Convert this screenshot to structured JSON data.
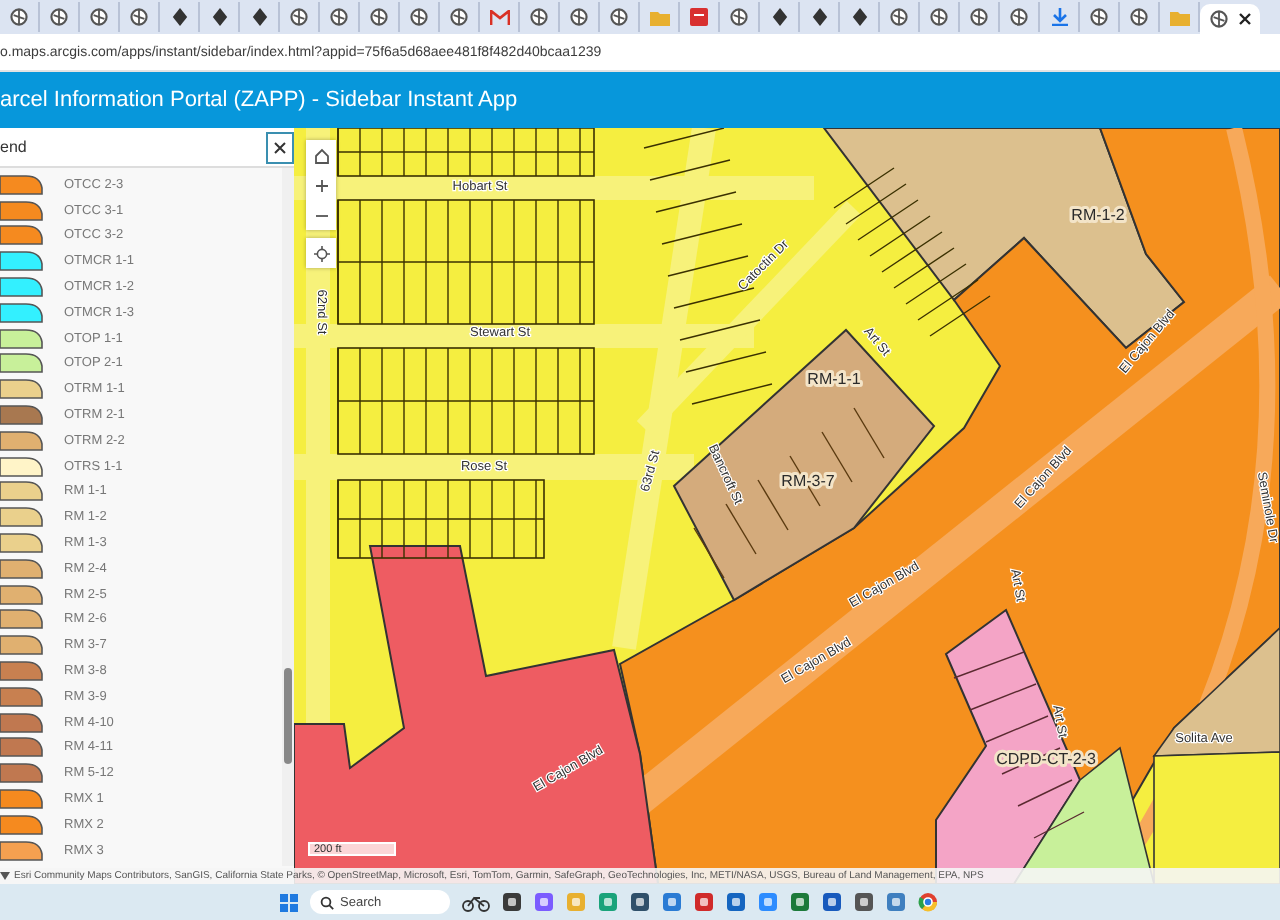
{
  "tabs": [
    {
      "kind": "globe",
      "selected": false
    },
    {
      "kind": "globe",
      "selected": false
    },
    {
      "kind": "globe",
      "selected": false
    },
    {
      "kind": "globe",
      "selected": false
    },
    {
      "kind": "pin",
      "selected": false
    },
    {
      "kind": "pin",
      "selected": false
    },
    {
      "kind": "pin",
      "selected": false
    },
    {
      "kind": "globe",
      "selected": false
    },
    {
      "kind": "globe",
      "selected": false
    },
    {
      "kind": "globe",
      "selected": false
    },
    {
      "kind": "globe",
      "selected": false
    },
    {
      "kind": "globe",
      "selected": false
    },
    {
      "kind": "mail",
      "selected": false
    },
    {
      "kind": "globe",
      "selected": false
    },
    {
      "kind": "globe",
      "selected": false
    },
    {
      "kind": "globe",
      "selected": false
    },
    {
      "kind": "folder",
      "selected": false
    },
    {
      "kind": "pdf",
      "selected": false
    },
    {
      "kind": "globe",
      "selected": false
    },
    {
      "kind": "pin",
      "selected": false
    },
    {
      "kind": "pin",
      "selected": false
    },
    {
      "kind": "pin",
      "selected": false
    },
    {
      "kind": "globe",
      "selected": false
    },
    {
      "kind": "globe",
      "selected": false
    },
    {
      "kind": "globe",
      "selected": false
    },
    {
      "kind": "globe",
      "selected": false
    },
    {
      "kind": "download",
      "selected": false
    },
    {
      "kind": "globe",
      "selected": false
    },
    {
      "kind": "globe",
      "selected": false
    },
    {
      "kind": "folder",
      "selected": false
    },
    {
      "kind": "globe",
      "selected": true
    }
  ],
  "address_bar": {
    "url": "o.maps.arcgis.com/apps/instant/sidebar/index.html?appid=75f6a5d68aee481f8f482d40bcaa1239"
  },
  "header": {
    "title": "arcel Information Portal (ZAPP) - Sidebar Instant App"
  },
  "sidebar": {
    "title": "end",
    "legend": [
      {
        "label": "OTCC 2-3",
        "color": "#f58a1f"
      },
      {
        "label": "OTCC 3-1",
        "color": "#f58a1f"
      },
      {
        "label": "OTCC 3-2",
        "color": "#f58a1f"
      },
      {
        "label": "OTMCR 1-1",
        "color": "#33f0ff"
      },
      {
        "label": "OTMCR 1-2",
        "color": "#33f0ff"
      },
      {
        "label": "OTMCR 1-3",
        "color": "#33f0ff"
      },
      {
        "label": "OTOP 1-1",
        "color": "#c8f09a"
      },
      {
        "label": "OTOP 2-1",
        "color": "#c8f09a"
      },
      {
        "label": "OTRM 1-1",
        "color": "#ead08c"
      },
      {
        "label": "OTRM 2-1",
        "color": "#a87850"
      },
      {
        "label": "OTRM 2-2",
        "color": "#e0b070"
      },
      {
        "label": "OTRS 1-1",
        "color": "#fff4c8"
      },
      {
        "label": "RM 1-1",
        "color": "#ead08c"
      },
      {
        "label": "RM 1-2",
        "color": "#ead08c"
      },
      {
        "label": "RM 1-3",
        "color": "#ead08c"
      },
      {
        "label": "RM 2-4",
        "color": "#e0b070"
      },
      {
        "label": "RM 2-5",
        "color": "#e0b070"
      },
      {
        "label": "RM 2-6",
        "color": "#e0b070"
      },
      {
        "label": "RM 3-7",
        "color": "#e0b070"
      },
      {
        "label": "RM 3-8",
        "color": "#c88050"
      },
      {
        "label": "RM 3-9",
        "color": "#c88050"
      },
      {
        "label": "RM 4-10",
        "color": "#c07850"
      },
      {
        "label": "RM 4-11",
        "color": "#c07850"
      },
      {
        "label": "RM 5-12",
        "color": "#c07850"
      },
      {
        "label": "RMX 1",
        "color": "#f58a1f"
      },
      {
        "label": "RMX 2",
        "color": "#f58a1f"
      },
      {
        "label": "RMX 3",
        "color": "#f5a050"
      }
    ]
  },
  "map": {
    "labels": [
      {
        "text": "Hobart St",
        "kind": "street"
      },
      {
        "text": "Stewart St",
        "kind": "street"
      },
      {
        "text": "Rose St",
        "kind": "street"
      },
      {
        "text": "62nd St",
        "kind": "street"
      },
      {
        "text": "63rd St",
        "kind": "street"
      },
      {
        "text": "Catoctin Dr",
        "kind": "street"
      },
      {
        "text": "Art St",
        "kind": "street"
      },
      {
        "text": "RM-1-1",
        "kind": "zone"
      },
      {
        "text": "Bancroft St",
        "kind": "street"
      },
      {
        "text": "RM-3-7",
        "kind": "zone"
      },
      {
        "text": "RM-1-2",
        "kind": "zone"
      },
      {
        "text": "El Cajon Blvd",
        "kind": "street"
      },
      {
        "text": "El Cajon Blvd",
        "kind": "street"
      },
      {
        "text": "El Cajon Blvd",
        "kind": "street"
      },
      {
        "text": "El Cajon Blvd",
        "kind": "street"
      },
      {
        "text": "El Cajon Blvd",
        "kind": "street"
      },
      {
        "text": "Art St",
        "kind": "street"
      },
      {
        "text": "Art St",
        "kind": "street"
      },
      {
        "text": "CDPD-CT-2-3",
        "kind": "zone"
      },
      {
        "text": "Solita Ave",
        "kind": "street"
      },
      {
        "text": "Seminole Dr",
        "kind": "street"
      }
    ],
    "scale_bar": "200 ft",
    "attribution": "Esri Community Maps Contributors, SanGIS, California State Parks, © OpenStreetMap, Microsoft, Esri, TomTom, Garmin, SafeGraph, GeoTechnologies, Inc, METI/NASA, USGS, Bureau of Land Management, EPA, NPS"
  },
  "taskbar": {
    "search_placeholder": "Search"
  }
}
